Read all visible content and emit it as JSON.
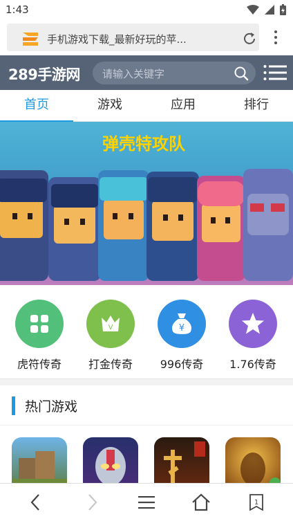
{
  "status": {
    "time": "1:43"
  },
  "browser": {
    "url_title": "手机游戏下载_最新好玩的苹..."
  },
  "site": {
    "brand": "289手游网",
    "search_placeholder": "请输入关键字"
  },
  "tabs": [
    {
      "label": "首页",
      "active": true
    },
    {
      "label": "游戏",
      "active": false
    },
    {
      "label": "应用",
      "active": false
    },
    {
      "label": "排行",
      "active": false
    }
  ],
  "banner": {
    "title": "弹壳特攻队"
  },
  "categories": [
    {
      "label": "虎符传奇",
      "color": "#52c07b",
      "icon": "grid-icon"
    },
    {
      "label": "打金传奇",
      "color": "#7fc04c",
      "icon": "crown-icon"
    },
    {
      "label": "996传奇",
      "color": "#2e8fe3",
      "icon": "money-bag-icon"
    },
    {
      "label": "1.76传奇",
      "color": "#8b63d6",
      "icon": "star-icon"
    }
  ],
  "hot": {
    "title": "热门游戏"
  },
  "accent": "#1e9be0",
  "header_bg": "#566377"
}
